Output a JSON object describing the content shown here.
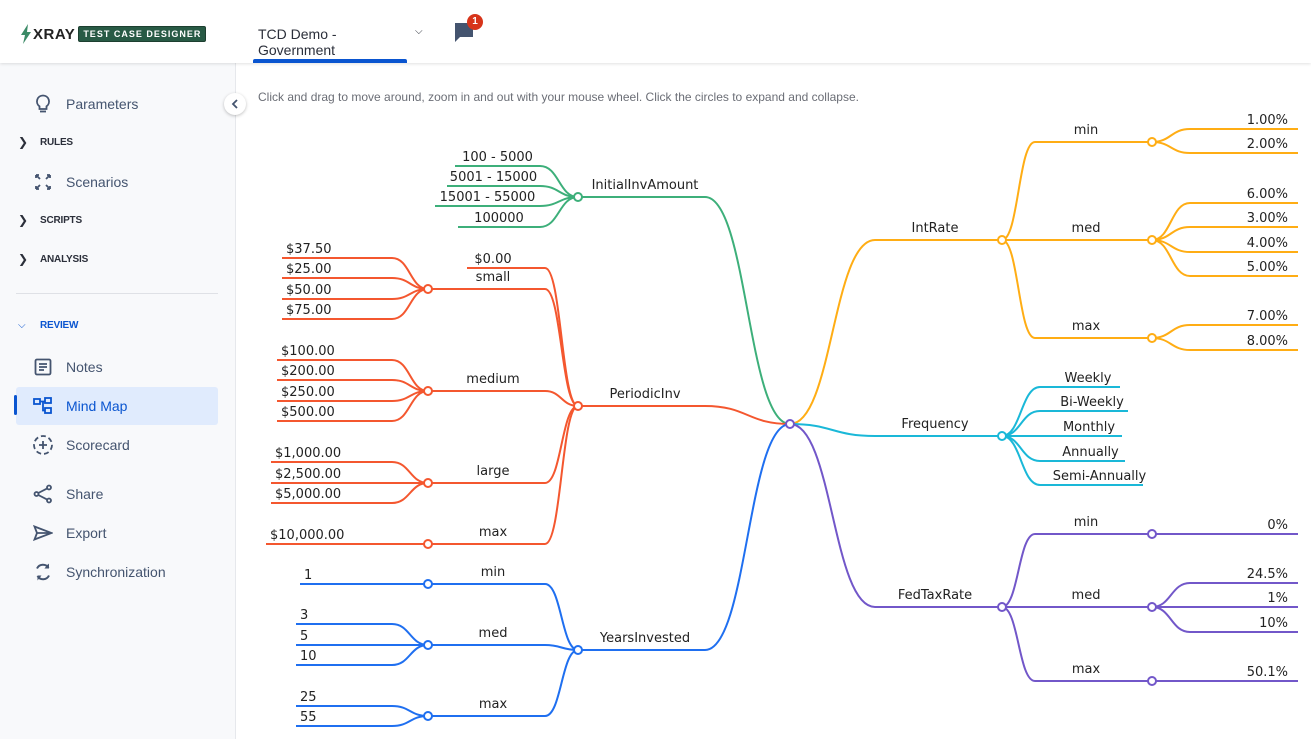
{
  "header": {
    "logo_text": "XRAY",
    "logo_badge": "TEST CASE DESIGNER",
    "project_name": "TCD Demo - Government",
    "notification_count": "1",
    "colors": {
      "accent": "#0a55d0",
      "logo_badge": "#285a45",
      "badge": "#d7341a"
    }
  },
  "sidebar": {
    "items": [
      {
        "type": "item",
        "label": "Parameters",
        "icon": "lightbulb-icon"
      },
      {
        "type": "section",
        "label": "RULES",
        "expanded": false
      },
      {
        "type": "item",
        "label": "Scenarios",
        "icon": "expand-arrows-icon"
      },
      {
        "type": "section",
        "label": "SCRIPTS",
        "expanded": false
      },
      {
        "type": "section",
        "label": "ANALYSIS",
        "expanded": false
      },
      {
        "type": "section",
        "label": "REVIEW",
        "expanded": true
      },
      {
        "type": "item",
        "label": "Notes",
        "icon": "notes-icon"
      },
      {
        "type": "item",
        "label": "Mind Map",
        "icon": "mindmap-icon",
        "active": true
      },
      {
        "type": "item",
        "label": "Scorecard",
        "icon": "scorecard-icon"
      },
      {
        "type": "item",
        "label": "Share",
        "icon": "share-icon"
      },
      {
        "type": "item",
        "label": "Export",
        "icon": "send-icon"
      },
      {
        "type": "item",
        "label": "Synchronization",
        "icon": "sync-icon"
      }
    ]
  },
  "main": {
    "hint": "Click and drag to move around, zoom in and out with your mouse wheel. Click the circles to expand and collapse."
  },
  "mindmap": {
    "branches": [
      {
        "name": "InitialInvAmount",
        "side": "left",
        "color": "#3daf7a",
        "children": [
          {
            "name": "100 - 5000"
          },
          {
            "name": "5001 - 15000"
          },
          {
            "name": "15001 - 55000"
          },
          {
            "name": "100000"
          }
        ]
      },
      {
        "name": "PeriodicInv",
        "side": "left",
        "color": "#f4572f",
        "children": [
          {
            "name": "$0.00"
          },
          {
            "name": "small",
            "children": [
              {
                "name": "$37.50"
              },
              {
                "name": "$25.00"
              },
              {
                "name": "$50.00"
              },
              {
                "name": "$75.00"
              }
            ]
          },
          {
            "name": "medium",
            "children": [
              {
                "name": "$100.00"
              },
              {
                "name": "$200.00"
              },
              {
                "name": "$250.00"
              },
              {
                "name": "$500.00"
              }
            ]
          },
          {
            "name": "large",
            "children": [
              {
                "name": "$1,000.00"
              },
              {
                "name": "$2,500.00"
              },
              {
                "name": "$5,000.00"
              }
            ]
          },
          {
            "name": "max",
            "children": [
              {
                "name": "$10,000.00"
              }
            ]
          }
        ]
      },
      {
        "name": "YearsInvested",
        "side": "left",
        "color": "#1f6ff0",
        "children": [
          {
            "name": "min",
            "children": [
              {
                "name": "1"
              }
            ]
          },
          {
            "name": "med",
            "children": [
              {
                "name": "3"
              },
              {
                "name": "5"
              },
              {
                "name": "10"
              }
            ]
          },
          {
            "name": "max",
            "children": [
              {
                "name": "25"
              },
              {
                "name": "55"
              }
            ]
          }
        ]
      },
      {
        "name": "IntRate",
        "side": "right",
        "color": "#ffad14",
        "children": [
          {
            "name": "min",
            "children": [
              {
                "name": "1.00%"
              },
              {
                "name": "2.00%"
              }
            ]
          },
          {
            "name": "med",
            "children": [
              {
                "name": "6.00%"
              },
              {
                "name": "3.00%"
              },
              {
                "name": "4.00%"
              },
              {
                "name": "5.00%"
              }
            ]
          },
          {
            "name": "max",
            "children": [
              {
                "name": "7.00%"
              },
              {
                "name": "8.00%"
              }
            ]
          }
        ]
      },
      {
        "name": "Frequency",
        "side": "right",
        "color": "#1ab8d8",
        "children": [
          {
            "name": "Weekly"
          },
          {
            "name": "Bi-Weekly"
          },
          {
            "name": "Monthly"
          },
          {
            "name": "Annually"
          },
          {
            "name": "Semi-Annually"
          }
        ]
      },
      {
        "name": "FedTaxRate",
        "side": "right",
        "color": "#7257c9",
        "children": [
          {
            "name": "min",
            "children": [
              {
                "name": "0%"
              }
            ]
          },
          {
            "name": "med",
            "children": [
              {
                "name": "24.5%"
              },
              {
                "name": "1%"
              },
              {
                "name": "10%"
              }
            ]
          },
          {
            "name": "max",
            "children": [
              {
                "name": "50.1%"
              }
            ]
          }
        ]
      }
    ],
    "root_color": "#7257c9"
  }
}
